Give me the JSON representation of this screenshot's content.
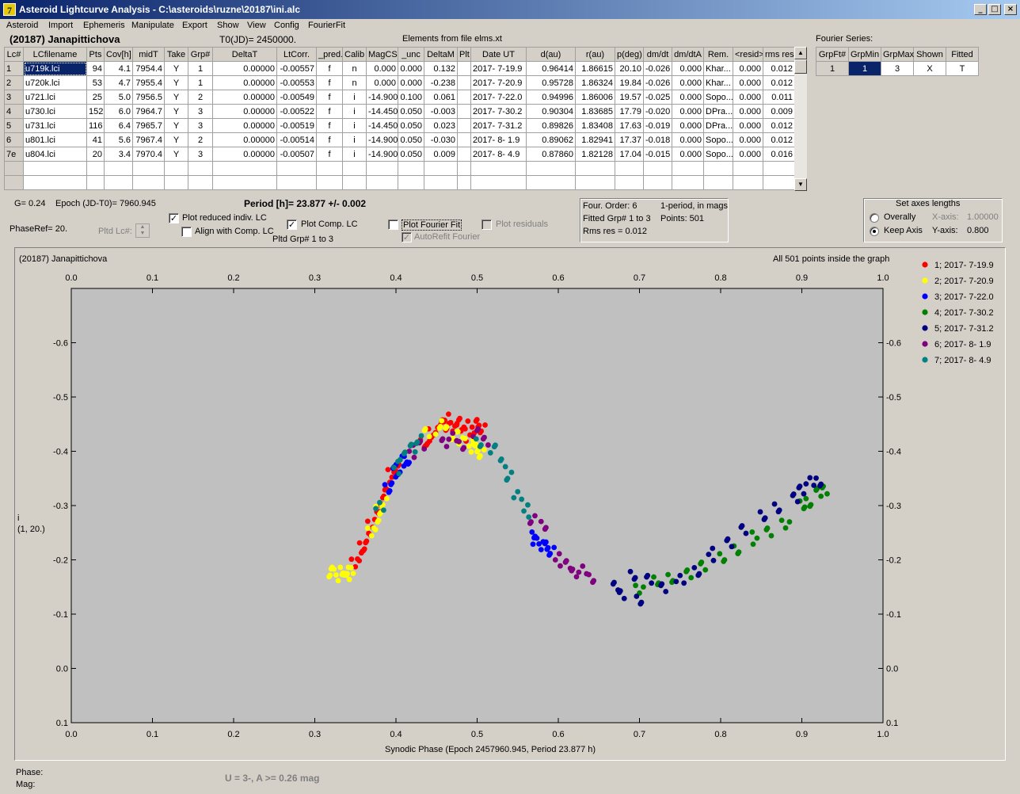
{
  "window": {
    "title": "Asteroid Lightcurve Analysis - C:\\asteroids\\ruzne\\20187\\ini.alc",
    "app_icon_glyph": "7",
    "minimize_glyph": "_",
    "maximize_glyph": "□",
    "close_glyph": "×"
  },
  "menu": [
    "Asteroid",
    "Import",
    "Ephemeris",
    "Manipulate",
    "Export",
    "Show",
    "View",
    "Config",
    "FourierFit"
  ],
  "header": {
    "asteroid_name": "(20187) Janapittichova",
    "t0": "T0(JD)= 2450000.",
    "elements": "Elements from file elms.xt",
    "fourier_series_label": "Fourier Series:"
  },
  "lc_table": {
    "columns": [
      "Lc#",
      "LCfilename",
      "Pts",
      "Cov[h]",
      "midT",
      "Take",
      "Grp#",
      "DeltaT",
      "LtCorr.",
      "_pred.",
      "Calib",
      "MagCS",
      "_unc",
      "DeltaM",
      "Plt",
      "Date UT",
      "d(au)",
      "r(au)",
      "p(deg)",
      "dm/dt",
      "dm/dtA",
      "Rem.",
      "<resid>",
      "rms res"
    ],
    "rows": [
      [
        "1",
        "u719k.lci",
        "94",
        "4.1",
        "7954.4",
        "Y",
        "1",
        "0.00000",
        "-0.00557",
        "f",
        "n",
        "0.000",
        "0.000",
        "0.132",
        "",
        "2017- 7-19.9",
        "0.96414",
        "1.86615",
        "20.10",
        "-0.026",
        "0.000",
        "Khar...",
        "0.000",
        "0.012"
      ],
      [
        "2",
        "u720k.lci",
        "53",
        "4.7",
        "7955.4",
        "Y",
        "1",
        "0.00000",
        "-0.00553",
        "f",
        "n",
        "0.000",
        "0.000",
        "-0.238",
        "",
        "2017- 7-20.9",
        "0.95728",
        "1.86324",
        "19.84",
        "-0.026",
        "0.000",
        "Khar...",
        "0.000",
        "0.012"
      ],
      [
        "3",
        "u721.lci",
        "25",
        "5.0",
        "7956.5",
        "Y",
        "2",
        "0.00000",
        "-0.00549",
        "f",
        "i",
        "-14.900",
        "0.100",
        "0.061",
        "",
        "2017- 7-22.0",
        "0.94996",
        "1.86006",
        "19.57",
        "-0.025",
        "0.000",
        "Sopo...",
        "0.000",
        "0.011"
      ],
      [
        "4",
        "u730.lci",
        "152",
        "6.0",
        "7964.7",
        "Y",
        "3",
        "0.00000",
        "-0.00522",
        "f",
        "i",
        "-14.450",
        "0.050",
        "-0.003",
        "",
        "2017- 7-30.2",
        "0.90304",
        "1.83685",
        "17.79",
        "-0.020",
        "0.000",
        "DPra...",
        "0.000",
        "0.009"
      ],
      [
        "5",
        "u731.lci",
        "116",
        "6.4",
        "7965.7",
        "Y",
        "3",
        "0.00000",
        "-0.00519",
        "f",
        "i",
        "-14.450",
        "0.050",
        "0.023",
        "",
        "2017- 7-31.2",
        "0.89826",
        "1.83408",
        "17.63",
        "-0.019",
        "0.000",
        "DPra...",
        "0.000",
        "0.012"
      ],
      [
        "6",
        "u801.lci",
        "41",
        "5.6",
        "7967.4",
        "Y",
        "2",
        "0.00000",
        "-0.00514",
        "f",
        "i",
        "-14.900",
        "0.050",
        "-0.030",
        "",
        "2017- 8- 1.9",
        "0.89062",
        "1.82941",
        "17.37",
        "-0.018",
        "0.000",
        "Sopo...",
        "0.000",
        "0.012"
      ],
      [
        "7e",
        "u804.lci",
        "20",
        "3.4",
        "7970.4",
        "Y",
        "3",
        "0.00000",
        "-0.00507",
        "f",
        "i",
        "-14.900",
        "0.050",
        "0.009",
        "",
        "2017- 8- 4.9",
        "0.87860",
        "1.82128",
        "17.04",
        "-0.015",
        "0.000",
        "Sopo...",
        "0.000",
        "0.016"
      ]
    ]
  },
  "fourier_table": {
    "columns": [
      "GrpFt#",
      "GrpMin",
      "GrpMax",
      "Shown",
      "Fitted"
    ],
    "row": [
      "1",
      "1",
      "3",
      "X",
      "T"
    ]
  },
  "info": {
    "g": "G= 0.24",
    "epoch": "Epoch (JD-T0)= 7960.945",
    "period": "Period [h]= 23.877 +/- 0.002",
    "phaseref": "PhaseRef= 20.",
    "pltd_lc": "Pltd Lc#:",
    "pltd_grp": "Pltd Grp#  1   to   3",
    "four_order": "Four. Order:  6",
    "one_period": "1-period, in mags",
    "fitted_grp": "Fitted Grp# 1 to 3",
    "points": "Points: 501",
    "rms_res": "Rms res     = 0.012"
  },
  "checkboxes": {
    "plot_reduced": {
      "label": "Plot reduced indiv. LC",
      "checked": true
    },
    "align_comp": {
      "label": "Align with Comp. LC",
      "checked": false
    },
    "plot_comp": {
      "label": "Plot Comp. LC",
      "checked": true
    },
    "plot_fourier": {
      "label": "Plot Fourier Fit",
      "checked": false
    },
    "autorefit": {
      "label": "AutoRefit Fourier",
      "checked": true
    },
    "plot_residuals": {
      "label": "Plot residuals",
      "checked": false
    }
  },
  "axes_box": {
    "title": "Set axes lengths",
    "overally": "Overally",
    "keep_axis": "Keep Axis",
    "x_axis_label": "X-axis:",
    "x_axis_value": "1.00000",
    "y_axis_label": "Y-axis:",
    "y_axis_value": "0.800",
    "selected": "keep_axis"
  },
  "plot": {
    "title_left": "(20187) Janapittichova",
    "title_right": "All 501 points inside the graph",
    "ylabel_line1": "i",
    "ylabel_line2": "(1, 20.)",
    "phase_label": "Phase:",
    "mag_label": "Mag:",
    "amplitude_note": "U = 3-, A >= 0.26 mag"
  },
  "chart_data": {
    "type": "scatter",
    "xlabel": "Synodic Phase (Epoch 2457960.945, Period 23.877 h)",
    "ylabel": "i (1, 20.)",
    "xlim": [
      0.0,
      1.0
    ],
    "ylim": [
      -0.7,
      0.1
    ],
    "y_inverted": true,
    "x_ticks": [
      "0.0",
      "0.1",
      "0.2",
      "0.3",
      "0.4",
      "0.5",
      "0.6",
      "0.7",
      "0.8",
      "0.9",
      "1.0"
    ],
    "y_ticks": [
      "-0.6",
      "-0.5",
      "-0.4",
      "-0.3",
      "-0.2",
      "-0.1",
      "0.0",
      "0.1"
    ],
    "grid": false,
    "legend_position": "right",
    "series": [
      {
        "name": "1; 2017- 7-19.9",
        "color": "#ff0000",
        "points": [
          [
            0.35,
            -0.19
          ],
          [
            0.355,
            -0.21
          ],
          [
            0.36,
            -0.22
          ],
          [
            0.365,
            -0.24
          ],
          [
            0.37,
            -0.26
          ],
          [
            0.375,
            -0.28
          ],
          [
            0.38,
            -0.3
          ],
          [
            0.385,
            -0.32
          ],
          [
            0.39,
            -0.34
          ],
          [
            0.395,
            -0.355
          ],
          [
            0.4,
            -0.37
          ],
          [
            0.435,
            -0.41
          ],
          [
            0.44,
            -0.42
          ],
          [
            0.445,
            -0.43
          ],
          [
            0.45,
            -0.44
          ],
          [
            0.455,
            -0.455
          ],
          [
            0.46,
            -0.46
          ],
          [
            0.465,
            -0.45
          ],
          [
            0.47,
            -0.44
          ],
          [
            0.475,
            -0.455
          ],
          [
            0.48,
            -0.44
          ],
          [
            0.485,
            -0.45
          ],
          [
            0.49,
            -0.43
          ],
          [
            0.495,
            -0.45
          ],
          [
            0.5,
            -0.445
          ],
          [
            0.505,
            -0.44
          ]
        ]
      },
      {
        "name": "2; 2017- 7-20.9",
        "color": "#ffff00",
        "points": [
          [
            0.32,
            -0.18
          ],
          [
            0.325,
            -0.175
          ],
          [
            0.33,
            -0.17
          ],
          [
            0.335,
            -0.175
          ],
          [
            0.34,
            -0.18
          ],
          [
            0.345,
            -0.175
          ],
          [
            0.37,
            -0.25
          ],
          [
            0.375,
            -0.27
          ],
          [
            0.38,
            -0.29
          ],
          [
            0.385,
            -0.31
          ],
          [
            0.44,
            -0.43
          ],
          [
            0.45,
            -0.44
          ],
          [
            0.46,
            -0.445
          ],
          [
            0.47,
            -0.43
          ],
          [
            0.48,
            -0.425
          ],
          [
            0.49,
            -0.415
          ],
          [
            0.495,
            -0.41
          ],
          [
            0.5,
            -0.405
          ],
          [
            0.505,
            -0.4
          ]
        ]
      },
      {
        "name": "3; 2017- 7-22.0",
        "color": "#0000ff",
        "points": [
          [
            0.39,
            -0.33
          ],
          [
            0.395,
            -0.35
          ],
          [
            0.4,
            -0.36
          ],
          [
            0.405,
            -0.37
          ],
          [
            0.41,
            -0.38
          ],
          [
            0.415,
            -0.385
          ],
          [
            0.57,
            -0.24
          ],
          [
            0.575,
            -0.235
          ],
          [
            0.58,
            -0.23
          ],
          [
            0.585,
            -0.225
          ],
          [
            0.59,
            -0.22
          ]
        ]
      },
      {
        "name": "4; 2017- 7-30.2",
        "color": "#008000",
        "points": [
          [
            0.7,
            -0.15
          ],
          [
            0.72,
            -0.16
          ],
          [
            0.74,
            -0.17
          ],
          [
            0.76,
            -0.17
          ],
          [
            0.78,
            -0.19
          ],
          [
            0.8,
            -0.2
          ],
          [
            0.82,
            -0.22
          ],
          [
            0.84,
            -0.24
          ],
          [
            0.86,
            -0.25
          ],
          [
            0.88,
            -0.27
          ],
          [
            0.9,
            -0.3
          ],
          [
            0.91,
            -0.31
          ],
          [
            0.92,
            -0.32
          ],
          [
            0.93,
            -0.33
          ]
        ]
      },
      {
        "name": "5; 2017- 7-31.2",
        "color": "#000080",
        "points": [
          [
            0.67,
            -0.15
          ],
          [
            0.68,
            -0.14
          ],
          [
            0.69,
            -0.17
          ],
          [
            0.7,
            -0.13
          ],
          [
            0.71,
            -0.16
          ],
          [
            0.73,
            -0.15
          ],
          [
            0.75,
            -0.16
          ],
          [
            0.77,
            -0.18
          ],
          [
            0.79,
            -0.21
          ],
          [
            0.81,
            -0.23
          ],
          [
            0.83,
            -0.26
          ],
          [
            0.85,
            -0.28
          ],
          [
            0.87,
            -0.3
          ],
          [
            0.89,
            -0.31
          ],
          [
            0.9,
            -0.33
          ],
          [
            0.91,
            -0.34
          ],
          [
            0.92,
            -0.345
          ]
        ]
      },
      {
        "name": "6; 2017- 8- 1.9",
        "color": "#800080",
        "points": [
          [
            0.42,
            -0.4
          ],
          [
            0.43,
            -0.41
          ],
          [
            0.46,
            -0.42
          ],
          [
            0.47,
            -0.425
          ],
          [
            0.48,
            -0.415
          ],
          [
            0.5,
            -0.43
          ],
          [
            0.51,
            -0.42
          ],
          [
            0.57,
            -0.27
          ],
          [
            0.58,
            -0.265
          ],
          [
            0.6,
            -0.2
          ],
          [
            0.61,
            -0.19
          ],
          [
            0.62,
            -0.18
          ],
          [
            0.63,
            -0.18
          ],
          [
            0.64,
            -0.17
          ]
        ]
      },
      {
        "name": "7; 2017- 8- 4.9",
        "color": "#008080",
        "points": [
          [
            0.38,
            -0.3
          ],
          [
            0.4,
            -0.37
          ],
          [
            0.41,
            -0.39
          ],
          [
            0.42,
            -0.41
          ],
          [
            0.43,
            -0.42
          ],
          [
            0.5,
            -0.42
          ],
          [
            0.52,
            -0.4
          ],
          [
            0.53,
            -0.38
          ],
          [
            0.54,
            -0.35
          ],
          [
            0.55,
            -0.32
          ],
          [
            0.56,
            -0.29
          ]
        ]
      }
    ]
  }
}
